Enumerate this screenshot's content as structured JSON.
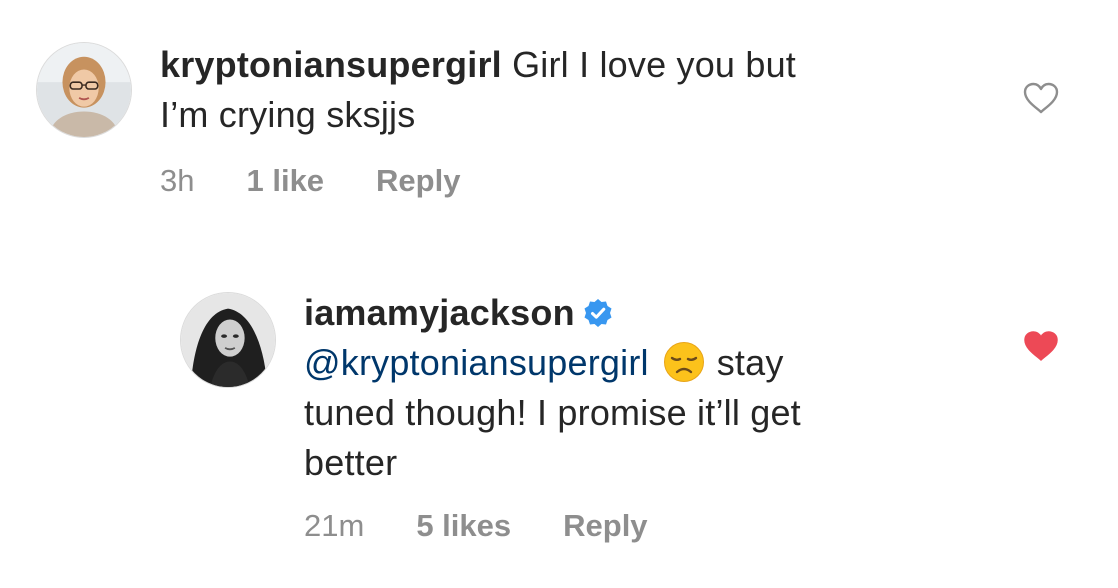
{
  "comments": [
    {
      "username": "kryptoniansupergirl",
      "text_line1": " Girl I love you but",
      "text_line2": "I’m crying sksjjs",
      "time": "3h",
      "likes": "1 like",
      "reply": "Reply",
      "liked": false,
      "avatar_icon": "avatar-photo-woman-glasses"
    },
    {
      "username": "iamamyjackson",
      "verified": true,
      "mention": "@kryptoniansupergirl",
      "emoji": "disappointed-face",
      "text_line1_after": "stay",
      "text_line2": "tuned though! I promise it’ll get",
      "text_line3": "better",
      "time": "21m",
      "likes": "5 likes",
      "reply": "Reply",
      "liked": true,
      "avatar_icon": "avatar-photo-woman-bw"
    }
  ],
  "colors": {
    "text": "#262626",
    "meta": "#8e8e8e",
    "mention": "#00376b",
    "liked_heart": "#ed4956",
    "verified": "#3897f0"
  }
}
